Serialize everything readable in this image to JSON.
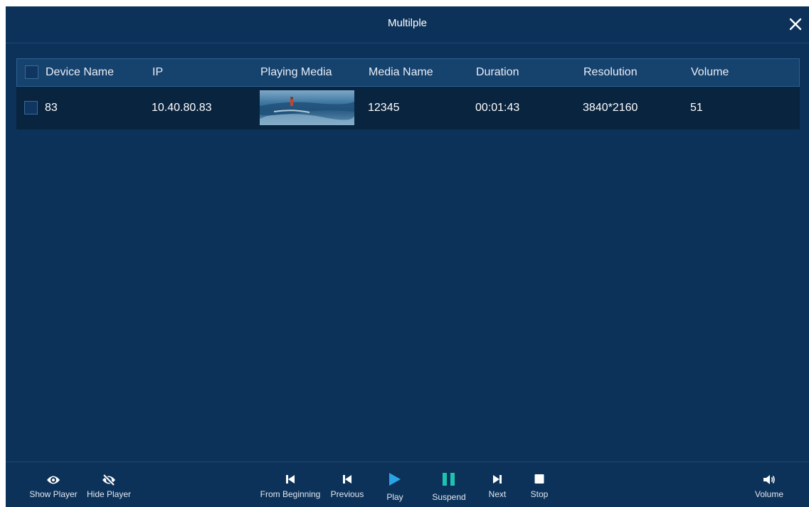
{
  "dialog": {
    "title": "Multilple"
  },
  "table": {
    "headers": [
      "Device Name",
      "IP",
      "Playing Media",
      "Media Name",
      "Duration",
      "Resolution",
      "Volume"
    ],
    "rows": [
      {
        "device_name": "83",
        "ip": "10.40.80.83",
        "media_name": "12345",
        "duration": "00:01:43",
        "resolution": "3840*2160",
        "volume": "51"
      }
    ]
  },
  "footer": {
    "show_player": "Show Player",
    "hide_player": "Hide Player",
    "from_beginning": "From Beginning",
    "previous": "Previous",
    "play": "Play",
    "suspend": "Suspend",
    "next": "Next",
    "stop": "Stop",
    "volume": "Volume"
  },
  "colors": {
    "background": "#0d3259",
    "header_row": "#16426e",
    "data_row": "#09243f",
    "play_accent": "#2aa4e6",
    "suspend_accent": "#1fc2b0"
  },
  "icons": [
    "close-icon",
    "eye-icon",
    "eye-off-icon",
    "skip-to-start-icon",
    "previous-icon",
    "play-icon",
    "pause-icon",
    "next-icon",
    "stop-icon",
    "volume-icon"
  ]
}
